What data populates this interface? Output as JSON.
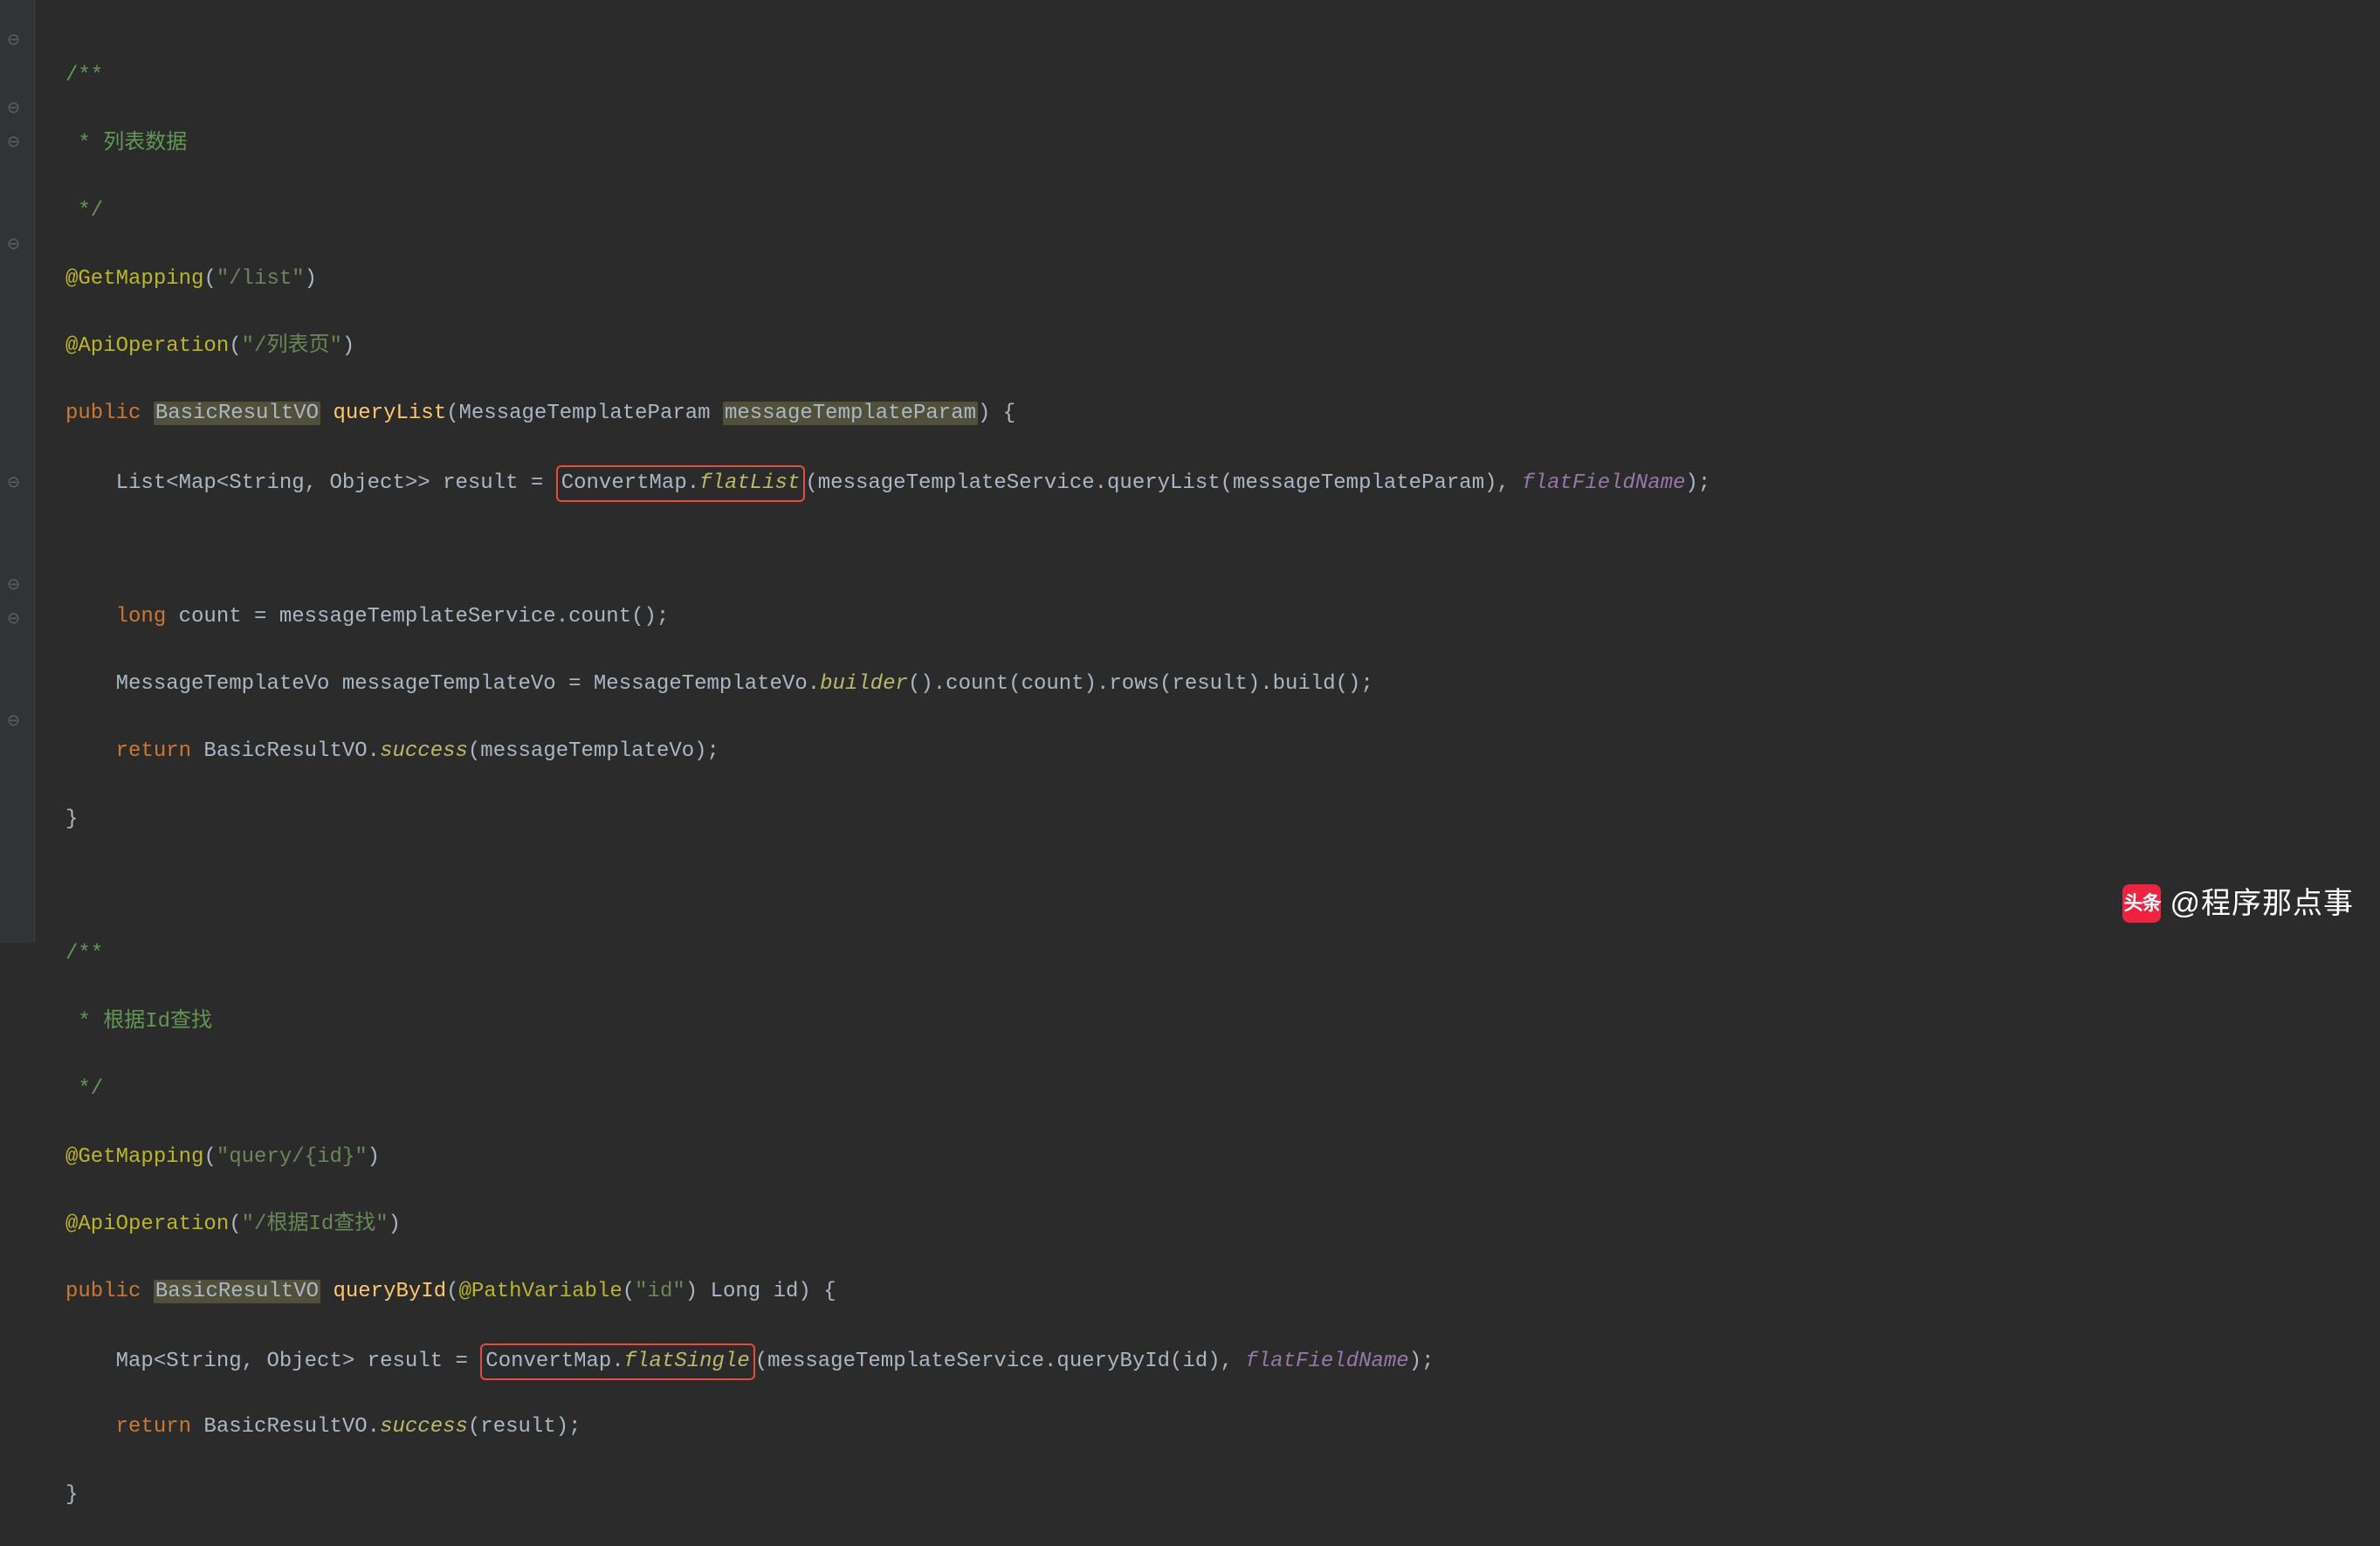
{
  "m1": {
    "doc_open": "/**",
    "doc_body": " * 列表数据",
    "doc_close": " */",
    "ann1_name": "@GetMapping",
    "ann1_arg": "\"/list\"",
    "ann2_name": "@ApiOperation",
    "ann2_arg": "\"/列表页\"",
    "kw_public": "public",
    "ret_type": "BasicResultVO",
    "method_name": "queryList",
    "param_type": "MessageTemplateParam",
    "param_name": "messageTemplateParam",
    "l1_type": "List<Map<String, Object>>",
    "l1_var": " result = ",
    "l1_call_class": "ConvertMap.",
    "l1_call_method": "flatList",
    "l1_args_a": "messageTemplateService.queryList(messageTemplateParam), ",
    "l1_args_b": "flatFieldName",
    "l2_kw": "long",
    "l2_rest": " count = messageTemplateService.count();",
    "l3_a": "MessageTemplateVo messageTemplateVo = MessageTemplateVo.",
    "l3_b": "builder",
    "l3_c": "().count(count).rows(result).build();",
    "l4_kw": "return",
    "l4_a": " BasicResultVO.",
    "l4_b": "success",
    "l4_c": "(messageTemplateVo);"
  },
  "m2": {
    "doc_open": "/**",
    "doc_body": " * 根据Id查找",
    "doc_close": " */",
    "ann1_name": "@GetMapping",
    "ann1_arg": "\"query/{id}\"",
    "ann2_name": "@ApiOperation",
    "ann2_arg": "\"/根据Id查找\"",
    "kw_public": "public",
    "ret_type": "BasicResultVO",
    "method_name": "queryById",
    "pv_ann": "@PathVariable",
    "pv_arg": "\"id\"",
    "param_type": "Long",
    "param_name": "id",
    "l1_type": "Map<String, Object>",
    "l1_var": " result = ",
    "l1_call_class": "ConvertMap.",
    "l1_call_method": "flatSingle",
    "l1_args_a": "messageTemplateService.queryById(id), ",
    "l1_args_b": "flatFieldName",
    "l2_kw": "return",
    "l2_a": " BasicResultVO.",
    "l2_b": "success",
    "l2_c": "(result);"
  },
  "sym": {
    "open_paren": "(",
    "close_paren": ")",
    "open_brace": " {",
    "close_brace": "}",
    "close_paren_brace": ") {",
    "close_paren_semi": ");",
    "comma_space": ", "
  },
  "watermark": {
    "logo": "头条",
    "handle": "@程序那点事"
  }
}
